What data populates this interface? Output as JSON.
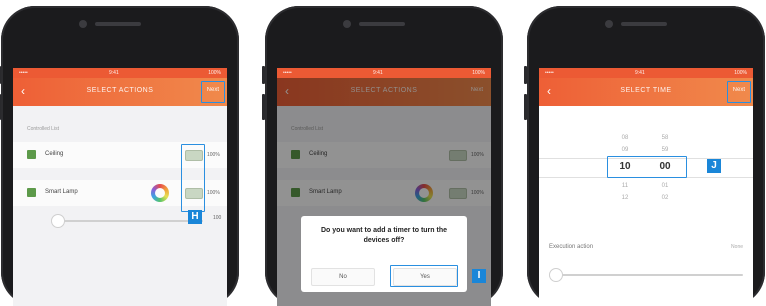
{
  "colors": {
    "accent_orange": "#ec5a34",
    "callout_blue": "#1a86d8",
    "checkbox_green": "#5d9a4a"
  },
  "screens": [
    {
      "statusbar": {
        "carrier": "•••••",
        "time": "9:41",
        "battery": "100%"
      },
      "header": {
        "back_icon": "chevron-left-icon",
        "title": "SELECT ACTIONS",
        "action": "Next"
      },
      "section_label": "Controlled List",
      "devices": [
        {
          "label": "Ceiling",
          "toggle_state": "on",
          "value": "100%"
        },
        {
          "label": "Smart Lamp",
          "toggle_state": "on",
          "value": "100%"
        }
      ],
      "slider_value": "100",
      "callout": "H"
    },
    {
      "statusbar": {
        "carrier": "•••••",
        "time": "9:41",
        "battery": "100%"
      },
      "header": {
        "back_icon": "chevron-left-icon",
        "title": "SELECT ACTIONS",
        "action": "Next"
      },
      "section_label": "Controlled List",
      "devices": [
        {
          "label": "Ceiling",
          "value": "100%"
        },
        {
          "label": "Smart Lamp",
          "value": "100%"
        }
      ],
      "dialog": {
        "message": "Do you want to add a timer to turn the devices off?",
        "no_label": "No",
        "yes_label": "Yes"
      },
      "callout": "I"
    },
    {
      "statusbar": {
        "carrier": "•••••",
        "time": "9:41",
        "battery": "100%"
      },
      "header": {
        "back_icon": "chevron-left-icon",
        "title": "SELECT TIME",
        "action": "Next"
      },
      "picker": {
        "hours_above": [
          "08",
          "09"
        ],
        "hour": "10",
        "hours_below": [
          "11",
          "12"
        ],
        "minutes_above": [
          "58",
          "59"
        ],
        "minute": "00",
        "minutes_below": [
          "01",
          "02"
        ]
      },
      "setting_label": "Execution action",
      "setting_value": "None",
      "callout": "J"
    }
  ]
}
